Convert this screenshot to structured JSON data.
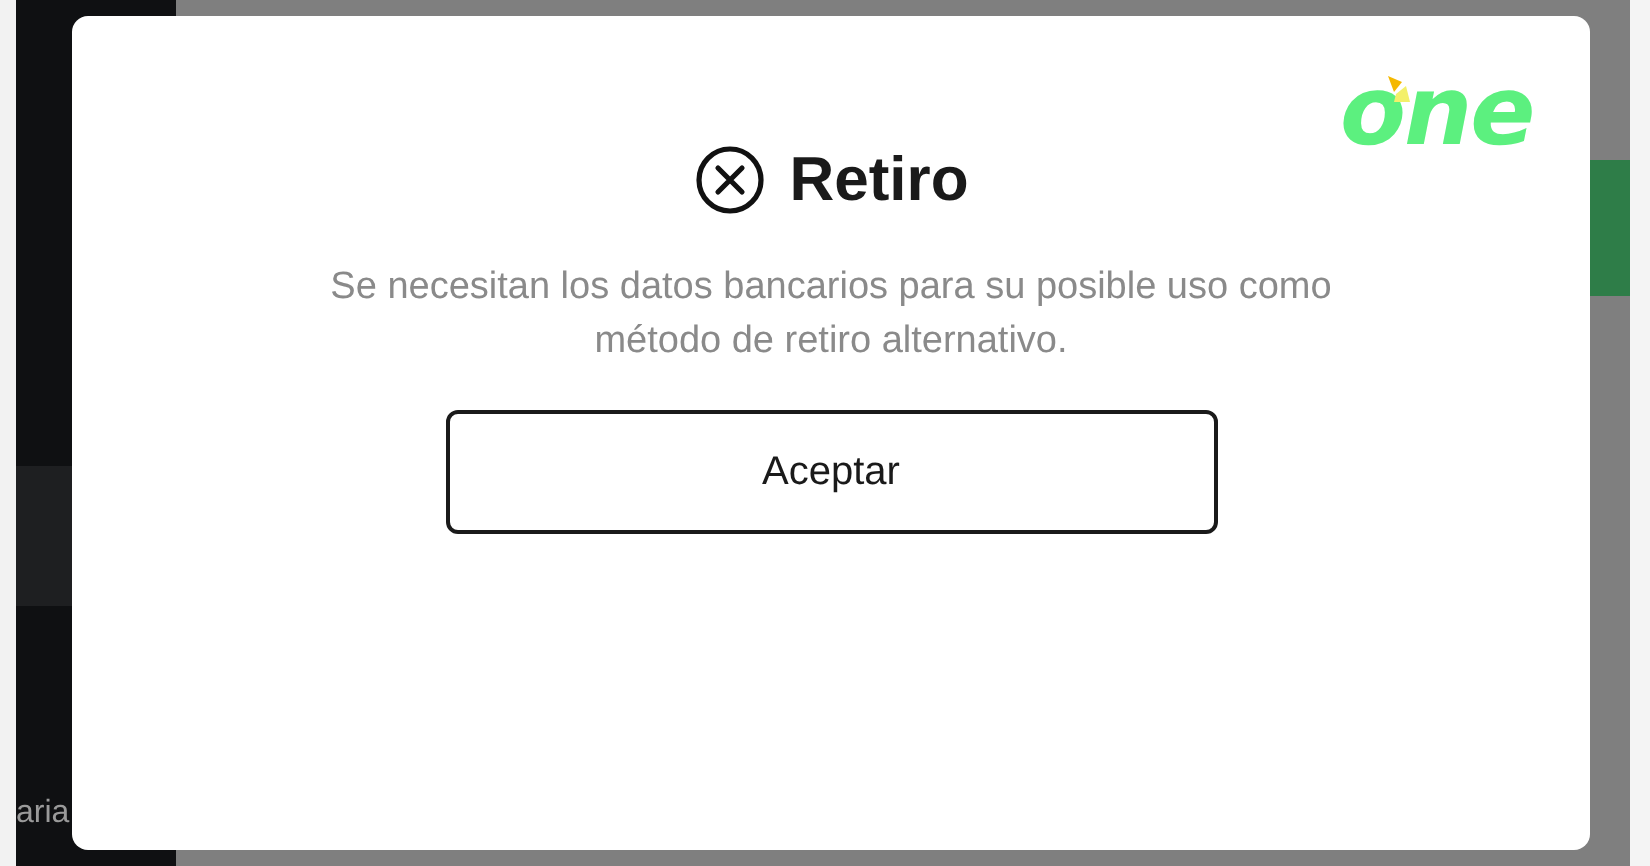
{
  "background": {
    "sidebar_label": "aria"
  },
  "logo": {
    "text": "one"
  },
  "dialog": {
    "title": "Retiro",
    "message": "Se necesitan los datos bancarios para su posible uso como método de retiro alternativo.",
    "button": "Aceptar"
  }
}
